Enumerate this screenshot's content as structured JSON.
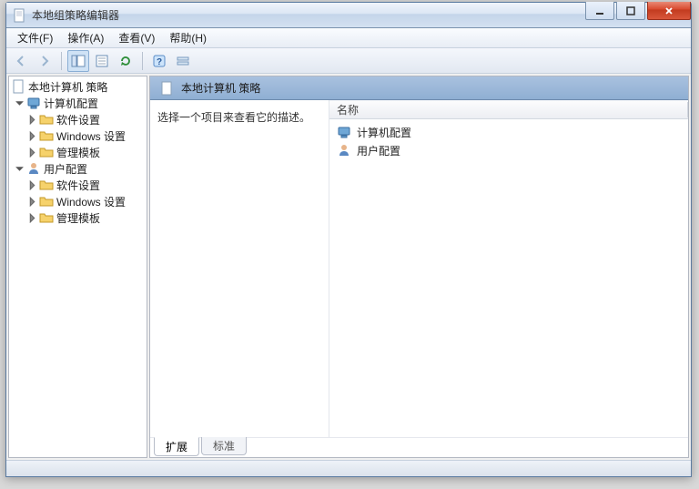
{
  "window": {
    "title": "本地组策略编辑器"
  },
  "menu": {
    "file": "文件(F)",
    "action": "操作(A)",
    "view": "查看(V)",
    "help": "帮助(H)"
  },
  "tree": {
    "root": "本地计算机 策略",
    "computer": {
      "label": "计算机配置",
      "software": "软件设置",
      "windows": "Windows 设置",
      "admin": "管理模板"
    },
    "user": {
      "label": "用户配置",
      "software": "软件设置",
      "windows": "Windows 设置",
      "admin": "管理模板"
    }
  },
  "header": {
    "title": "本地计算机 策略"
  },
  "desc": {
    "hint": "选择一个项目来查看它的描述。"
  },
  "columns": {
    "name": "名称"
  },
  "items": {
    "computer": "计算机配置",
    "user": "用户配置"
  },
  "tabs": {
    "extended": "扩展",
    "standard": "标准"
  }
}
